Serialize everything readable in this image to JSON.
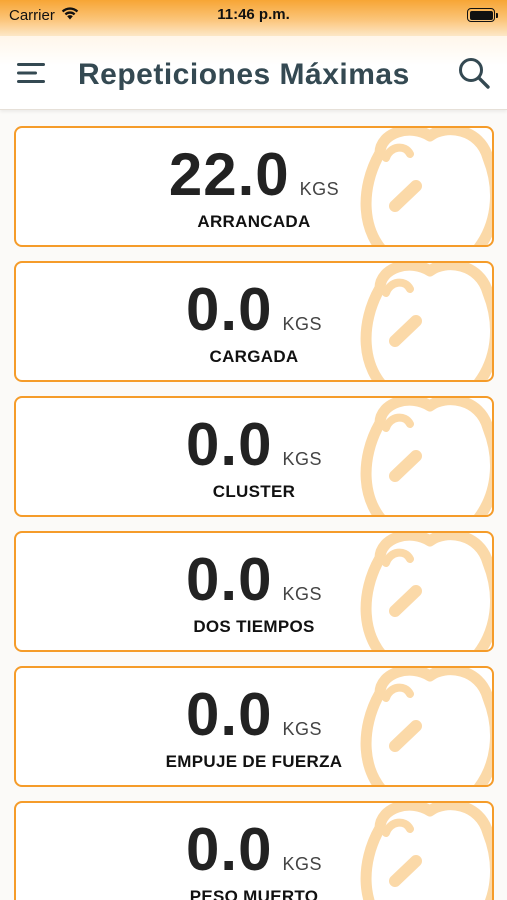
{
  "status_bar": {
    "carrier": "Carrier",
    "time": "11:46 p.m."
  },
  "header": {
    "title": "Repeticiones Máximas",
    "menu_icon": "hamburger-menu-icon",
    "search_icon": "search-icon"
  },
  "colors": {
    "accent": "#f59c2a",
    "title": "#344952",
    "watermark": "#fbd9a8"
  },
  "records": [
    {
      "value": "22.0",
      "unit": "KGS",
      "name": "ARRANCADA"
    },
    {
      "value": "0.0",
      "unit": "KGS",
      "name": "CARGADA"
    },
    {
      "value": "0.0",
      "unit": "KGS",
      "name": "CLUSTER"
    },
    {
      "value": "0.0",
      "unit": "KGS",
      "name": "DOS TIEMPOS"
    },
    {
      "value": "0.0",
      "unit": "KGS",
      "name": "EMPUJE DE FUERZA"
    },
    {
      "value": "0.0",
      "unit": "KGS",
      "name": "PESO MUERTO"
    }
  ]
}
